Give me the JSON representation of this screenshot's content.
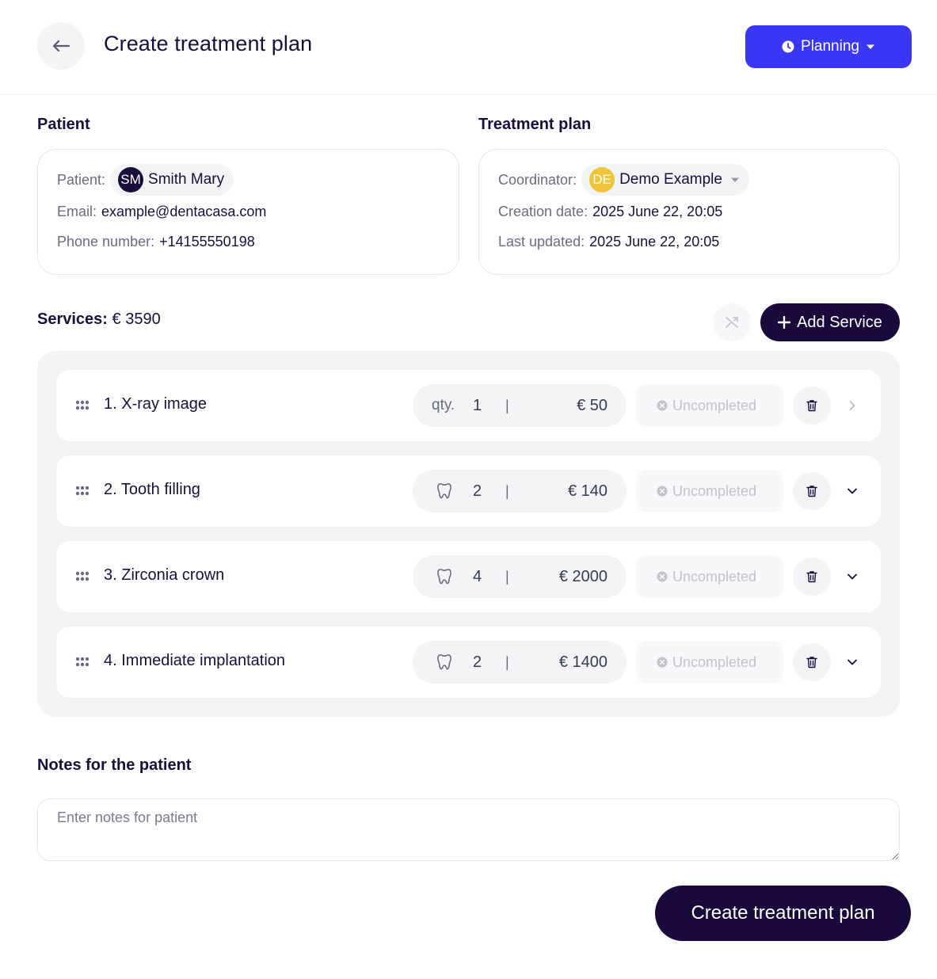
{
  "header": {
    "title": "Create treatment plan",
    "status_button": "Planning"
  },
  "patient_section": {
    "heading": "Patient",
    "patient_label": "Patient:",
    "patient_initials": "SM",
    "patient_name": "Smith Mary",
    "email_label": "Email:",
    "email": "example@dentacasa.com",
    "phone_label": "Phone number:",
    "phone": "+14155550198"
  },
  "plan_section": {
    "heading": "Treatment plan",
    "coordinator_label": "Coordinator:",
    "coordinator_initials": "DE",
    "coordinator_name": "Demo Example",
    "creation_label": "Creation date:",
    "creation_date": "2025 June 22, 20:05",
    "updated_label": "Last updated:",
    "updated_date": "2025 June 22, 20:05"
  },
  "services": {
    "title_label": "Services:",
    "total": "€ 3590",
    "add_button": "Add Service",
    "items": [
      {
        "name": "1. X-ray image",
        "qty_label": "qty.",
        "qty": "1",
        "sep": "|",
        "price": "€ 50",
        "status": "Uncompleted",
        "unit_icon": "none",
        "expand_icon": "chevron-right-icon"
      },
      {
        "name": "2. Tooth filling",
        "qty_label": "",
        "qty": "2",
        "sep": "|",
        "price": "€ 140",
        "status": "Uncompleted",
        "unit_icon": "tooth-icon",
        "expand_icon": "chevron-down-icon"
      },
      {
        "name": "3. Zirconia crown",
        "qty_label": "",
        "qty": "4",
        "sep": "|",
        "price": "€ 2000",
        "status": "Uncompleted",
        "unit_icon": "tooth-icon",
        "expand_icon": "chevron-down-icon"
      },
      {
        "name": "4. Immediate implantation",
        "qty_label": "",
        "qty": "2",
        "sep": "|",
        "price": "€ 1400",
        "status": "Uncompleted",
        "unit_icon": "tooth-icon",
        "expand_icon": "chevron-down-icon"
      }
    ]
  },
  "notes": {
    "heading": "Notes for the patient",
    "placeholder": "Enter notes for patient",
    "value": ""
  },
  "footer": {
    "create_button": "Create treatment plan"
  },
  "colors": {
    "primary": "#3a36f5",
    "dark": "#1a0a3c",
    "panel_bg": "#f3f4f6",
    "coordinator_avatar": "#f0c43b"
  }
}
